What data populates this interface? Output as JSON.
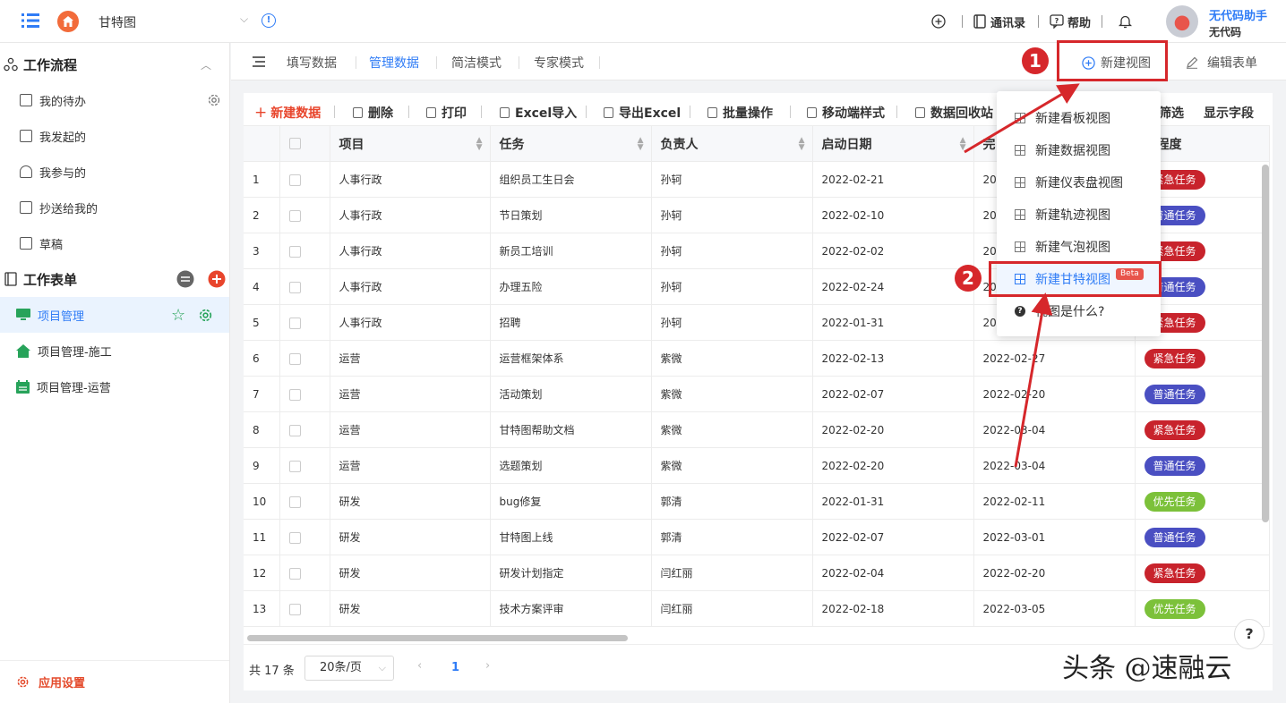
{
  "topbar": {
    "app_title": "甘特图",
    "contacts_label": "通讯录",
    "help_label": "帮助",
    "user_name": "无代码助手",
    "user_org": "无代码"
  },
  "sidebar": {
    "workflow_title": "工作流程",
    "workflow_items": [
      {
        "label": "我的待办",
        "icon": "checkbox-icon"
      },
      {
        "label": "我发起的",
        "icon": "document-icon"
      },
      {
        "label": "我参与的",
        "icon": "user-icon"
      },
      {
        "label": "抄送给我的",
        "icon": "share-icon"
      },
      {
        "label": "草稿",
        "icon": "draft-icon"
      }
    ],
    "forms_title": "工作表单",
    "form_items": [
      {
        "label": "项目管理",
        "active": true,
        "icon_color": "#27a35a"
      },
      {
        "label": "项目管理-施工",
        "active": false,
        "icon_color": "#27a35a"
      },
      {
        "label": "项目管理-运营",
        "active": false,
        "icon_color": "#27a35a"
      }
    ],
    "settings_label": "应用设置"
  },
  "tabs": {
    "items": [
      "填写数据",
      "管理数据",
      "简洁模式",
      "专家模式"
    ],
    "active_index": 1,
    "new_view_label": "新建视图",
    "edit_form_label": "编辑表单"
  },
  "toolbar": {
    "new_data": "新建数据",
    "delete": "删除",
    "print": "打印",
    "excel_import": "Excel导入",
    "export_excel": "导出Excel",
    "batch": "批量操作",
    "mobile_style": "移动端样式",
    "recycle": "数据回收站",
    "filter": "筛选",
    "show_fields": "显示字段"
  },
  "table": {
    "headers": [
      "项目",
      "任务",
      "负责人",
      "启动日期",
      "完",
      "急程度"
    ],
    "rows": [
      [
        "1",
        "人事行政",
        "组织员工生日会",
        "孙轲",
        "2022-02-21",
        "20",
        "紧急任务"
      ],
      [
        "2",
        "人事行政",
        "节日策划",
        "孙轲",
        "2022-02-10",
        "20",
        "普通任务"
      ],
      [
        "3",
        "人事行政",
        "新员工培训",
        "孙轲",
        "2022-02-02",
        "20",
        "紧急任务"
      ],
      [
        "4",
        "人事行政",
        "办理五险",
        "孙轲",
        "2022-02-24",
        "20",
        "普通任务"
      ],
      [
        "5",
        "人事行政",
        "招聘",
        "孙轲",
        "2022-01-31",
        "20",
        "紧急任务"
      ],
      [
        "6",
        "运营",
        "运营框架体系",
        "紫微",
        "2022-02-13",
        "2022-02-27",
        "紧急任务"
      ],
      [
        "7",
        "运营",
        "活动策划",
        "紫微",
        "2022-02-07",
        "2022-02-20",
        "普通任务"
      ],
      [
        "8",
        "运营",
        "甘特图帮助文档",
        "紫微",
        "2022-02-20",
        "2022-03-04",
        "紧急任务"
      ],
      [
        "9",
        "运营",
        "选题策划",
        "紫微",
        "2022-02-20",
        "2022-03-04",
        "普通任务"
      ],
      [
        "10",
        "研发",
        "bug修复",
        "郭清",
        "2022-01-31",
        "2022-02-11",
        "优先任务"
      ],
      [
        "11",
        "研发",
        "甘特图上线",
        "郭清",
        "2022-02-07",
        "2022-03-01",
        "普通任务"
      ],
      [
        "12",
        "研发",
        "研发计划指定",
        "闫红丽",
        "2022-02-04",
        "2022-02-20",
        "紧急任务"
      ],
      [
        "13",
        "研发",
        "技术方案评审",
        "闫红丽",
        "2022-02-18",
        "2022-03-05",
        "优先任务"
      ]
    ],
    "tag_colors": {
      "紧急任务": "#c8232c",
      "普通任务": "#4a4fc2",
      "优先任务": "#7cc13a"
    }
  },
  "pager": {
    "total": "共 17 条",
    "page_size": "20条/页",
    "current_page": "1"
  },
  "dropdown": {
    "items": [
      "新建看板视图",
      "新建数据视图",
      "新建仪表盘视图",
      "新建轨迹视图",
      "新建气泡视图",
      "新建甘特视图"
    ],
    "beta": "Beta",
    "what_is": "视图是什么?"
  },
  "annotations": {
    "badge1": "1",
    "badge2": "2"
  },
  "watermark": "头条 @速融云"
}
